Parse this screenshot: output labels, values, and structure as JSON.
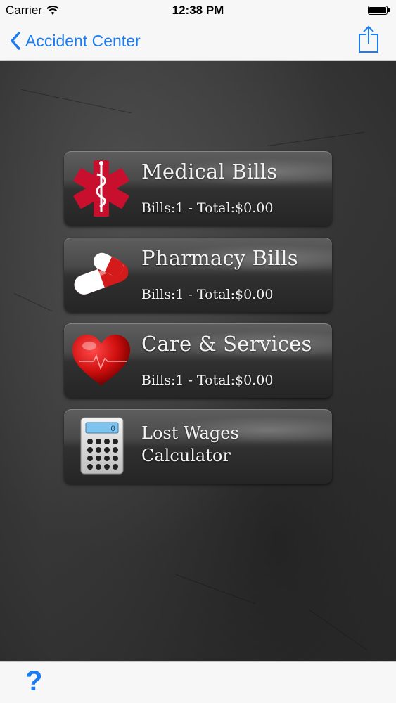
{
  "status_bar": {
    "carrier": "Carrier",
    "time": "12:38 PM"
  },
  "nav": {
    "back_label": "Accident Center"
  },
  "menu": [
    {
      "title": "Medical Bills",
      "subtitle": "Bills:1 - Total:$0.00",
      "icon": "medical-star-icon"
    },
    {
      "title": "Pharmacy Bills",
      "subtitle": "Bills:1 - Total:$0.00",
      "icon": "pill-capsule-icon"
    },
    {
      "title": "Care & Services",
      "subtitle": "Bills:1 - Total:$0.00",
      "icon": "heart-icon"
    },
    {
      "title_line1": "Lost Wages",
      "title_line2": "Calculator",
      "calc_display": "0",
      "icon": "calculator-icon"
    }
  ],
  "toolbar": {
    "help_label": "?"
  },
  "colors": {
    "accent": "#1a7cf0",
    "bar_bg": "#f7f7f7",
    "medical_red": "#c8102e"
  }
}
